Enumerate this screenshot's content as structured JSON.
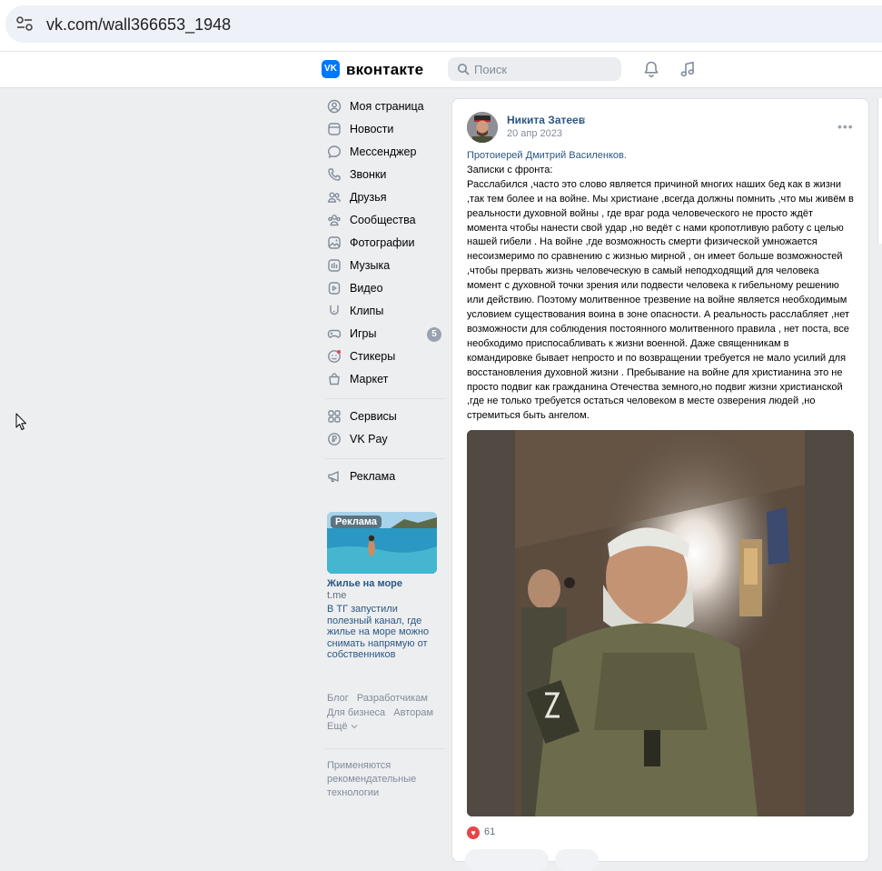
{
  "browser": {
    "url": "vk.com/wall366653_1948",
    "site_info_icon": "site-settings-icon"
  },
  "header": {
    "logo_glyph": "VK",
    "brand": "вконтакте",
    "search_placeholder": "Поиск",
    "icons": [
      "bell-icon",
      "music-icon"
    ]
  },
  "sidebar": {
    "items": [
      {
        "label": "Моя страница",
        "icon": "profile-icon"
      },
      {
        "label": "Новости",
        "icon": "news-icon"
      },
      {
        "label": "Мессенджер",
        "icon": "chat-icon"
      },
      {
        "label": "Звонки",
        "icon": "phone-icon"
      },
      {
        "label": "Друзья",
        "icon": "friends-icon"
      },
      {
        "label": "Сообщества",
        "icon": "communities-icon"
      },
      {
        "label": "Фотографии",
        "icon": "photos-icon"
      },
      {
        "label": "Музыка",
        "icon": "music-icon"
      },
      {
        "label": "Видео",
        "icon": "video-icon"
      },
      {
        "label": "Клипы",
        "icon": "clips-icon"
      },
      {
        "label": "Игры",
        "icon": "games-icon",
        "badge": "5"
      },
      {
        "label": "Стикеры",
        "icon": "stickers-icon"
      },
      {
        "label": "Маркет",
        "icon": "market-icon"
      }
    ],
    "items2": [
      {
        "label": "Сервисы",
        "icon": "services-icon"
      },
      {
        "label": "VK Pay",
        "icon": "vkpay-icon"
      }
    ],
    "items3": [
      {
        "label": "Реклама",
        "icon": "megaphone-icon"
      }
    ]
  },
  "ad": {
    "label": "Реклама",
    "title": "Жилье на море",
    "domain": "t.me",
    "description": "В ТГ запустили полезный канал, где жилье на море можно снимать напрямую от собственников"
  },
  "footer": {
    "links": [
      "Блог",
      "Разработчикам",
      "Для бизнеса",
      "Авторам",
      "Ещё"
    ],
    "recommendation_note": "Применяются рекомендательные технологии"
  },
  "post": {
    "author": "Никита Затеев",
    "verified_mark": "✓",
    "date": "20 апр 2023",
    "menu_glyph": "•••",
    "text_link": "Протоиерей Дмитрий Василенков.",
    "text_line2": "Записки с фронта:",
    "text_body": "Расслабился ,часто это слово является причиной многих наших бед как в жизни ,так тем более и на войне. Мы христиане ,всегда должны помнить ,что мы живём в реальности духовной войны , где враг рода человеческого не просто ждёт момента чтобы нанести свой удар ,но ведёт с нами кропотливую работу с целью нашей гибели . На войне ,где возможность смерти физической умножается несоизмеримо по сравнению с жизнью мирной , он имеет больше возможностей ,чтобы прервать жизнь человеческую в самый неподходящий для человека момент с духовной точки зрения или подвести человека к гибельному решению или действию. Поэтому молитвенное трезвение на войне является необходимым условием существования воина в зоне опасности. А реальность расслабляет ,нет возможности для соблюдения постоянного молитвенного правила , нет поста, все необходимо приспосабливать к жизни военной. Даже священникам в командировке бывает непросто и по возвращении требуется не мало усилий для восстановления духовной жизни . Пребывание на войне для христианина это не просто подвиг как гражданина Отечества земного,но подвиг жизни христианской ,где не только требуется остаться человеком в месте озверения людей ,но стремиться быть ангелом.",
    "likes": "61",
    "like_glyph": "♥"
  }
}
